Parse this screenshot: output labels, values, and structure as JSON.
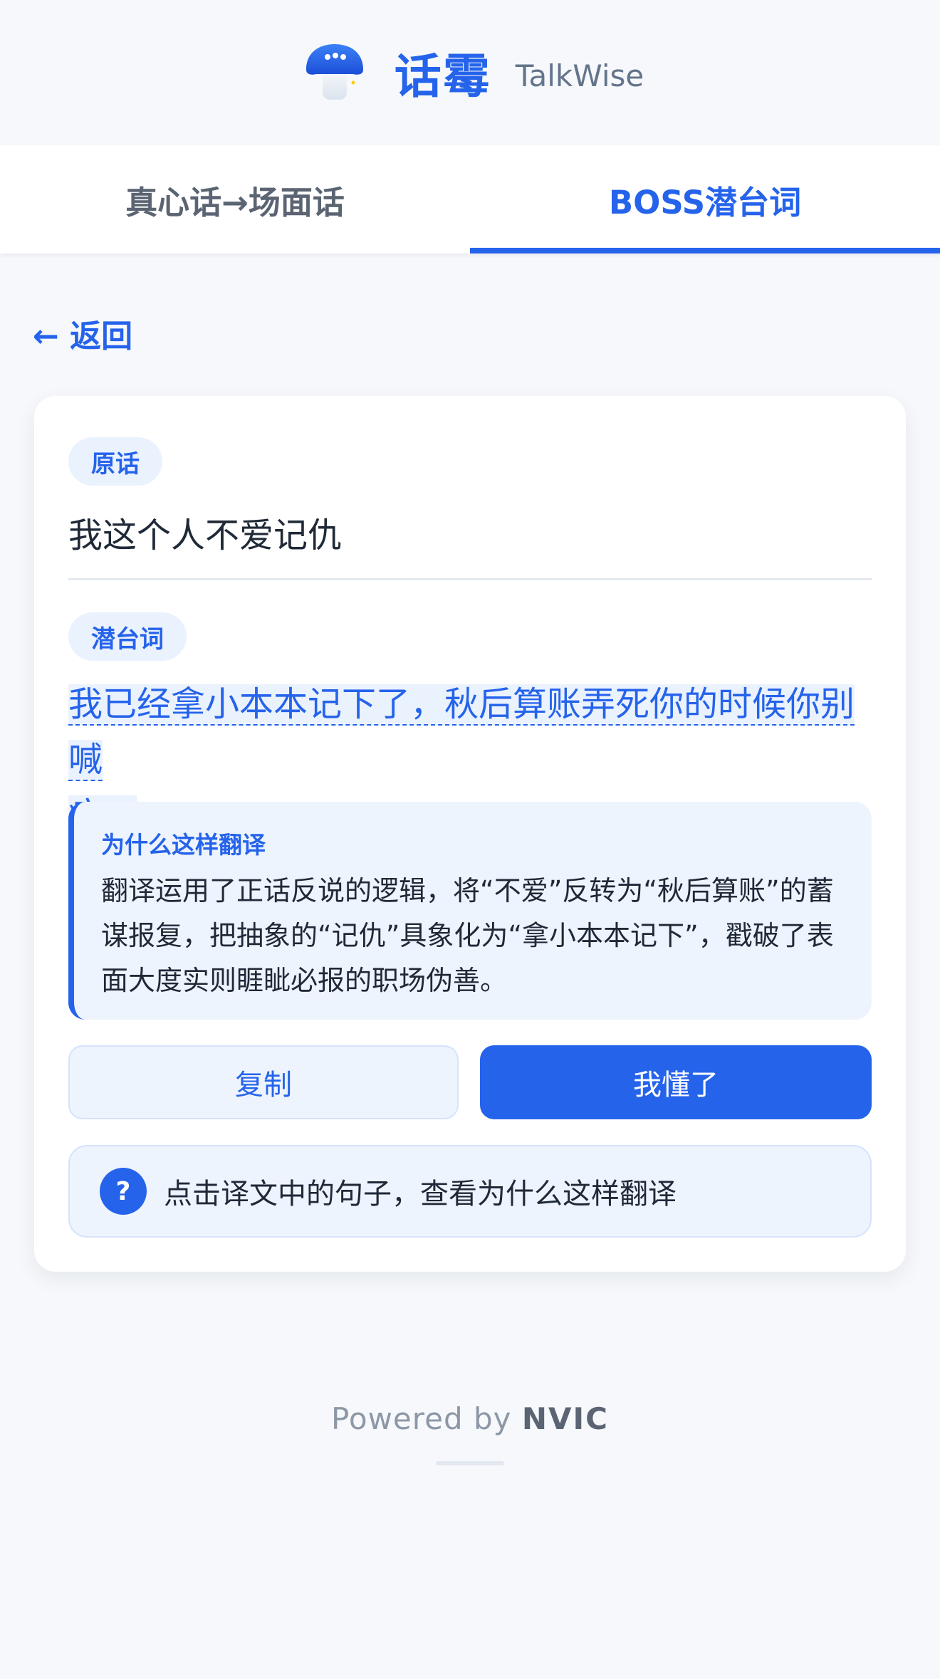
{
  "header": {
    "app_name": "话霉",
    "app_subtitle": "TalkWise",
    "logo_icon": "mushroom-chat-icon"
  },
  "tabs": [
    {
      "label": "真心话→场面话",
      "active": false
    },
    {
      "label": "BOSS潜台词",
      "active": true
    }
  ],
  "back": {
    "label": "← 返回"
  },
  "card": {
    "original_label": "原话",
    "original_text": "我这个人不爱记仇",
    "subtext_label": "潜台词",
    "subtext_line1": "我已经拿小本本记下了，秋后算账弄死你的时候你别喊",
    "subtext_line2": "疼。",
    "explanation": {
      "title": "为什么这样翻译",
      "body": "翻译运用了正话反说的逻辑，将“不爱”反转为“秋后算账”的蓄谋报复，把抽象的“记仇”具象化为“拿小本本记下”，戳破了表面大度实则睚眦必报的职场伪善。"
    },
    "copy_button": "复制",
    "ok_button": "我懂了",
    "hint": {
      "icon": "question-icon",
      "icon_glyph": "?",
      "text": "点击译文中的句子，查看为什么这样翻译"
    }
  },
  "footer": {
    "powered_prefix": "Powered by",
    "powered_brand": "NVIC"
  },
  "colors": {
    "accent": "#2563eb",
    "background": "#f6f8fb",
    "accent_light": "#eef4fe"
  }
}
